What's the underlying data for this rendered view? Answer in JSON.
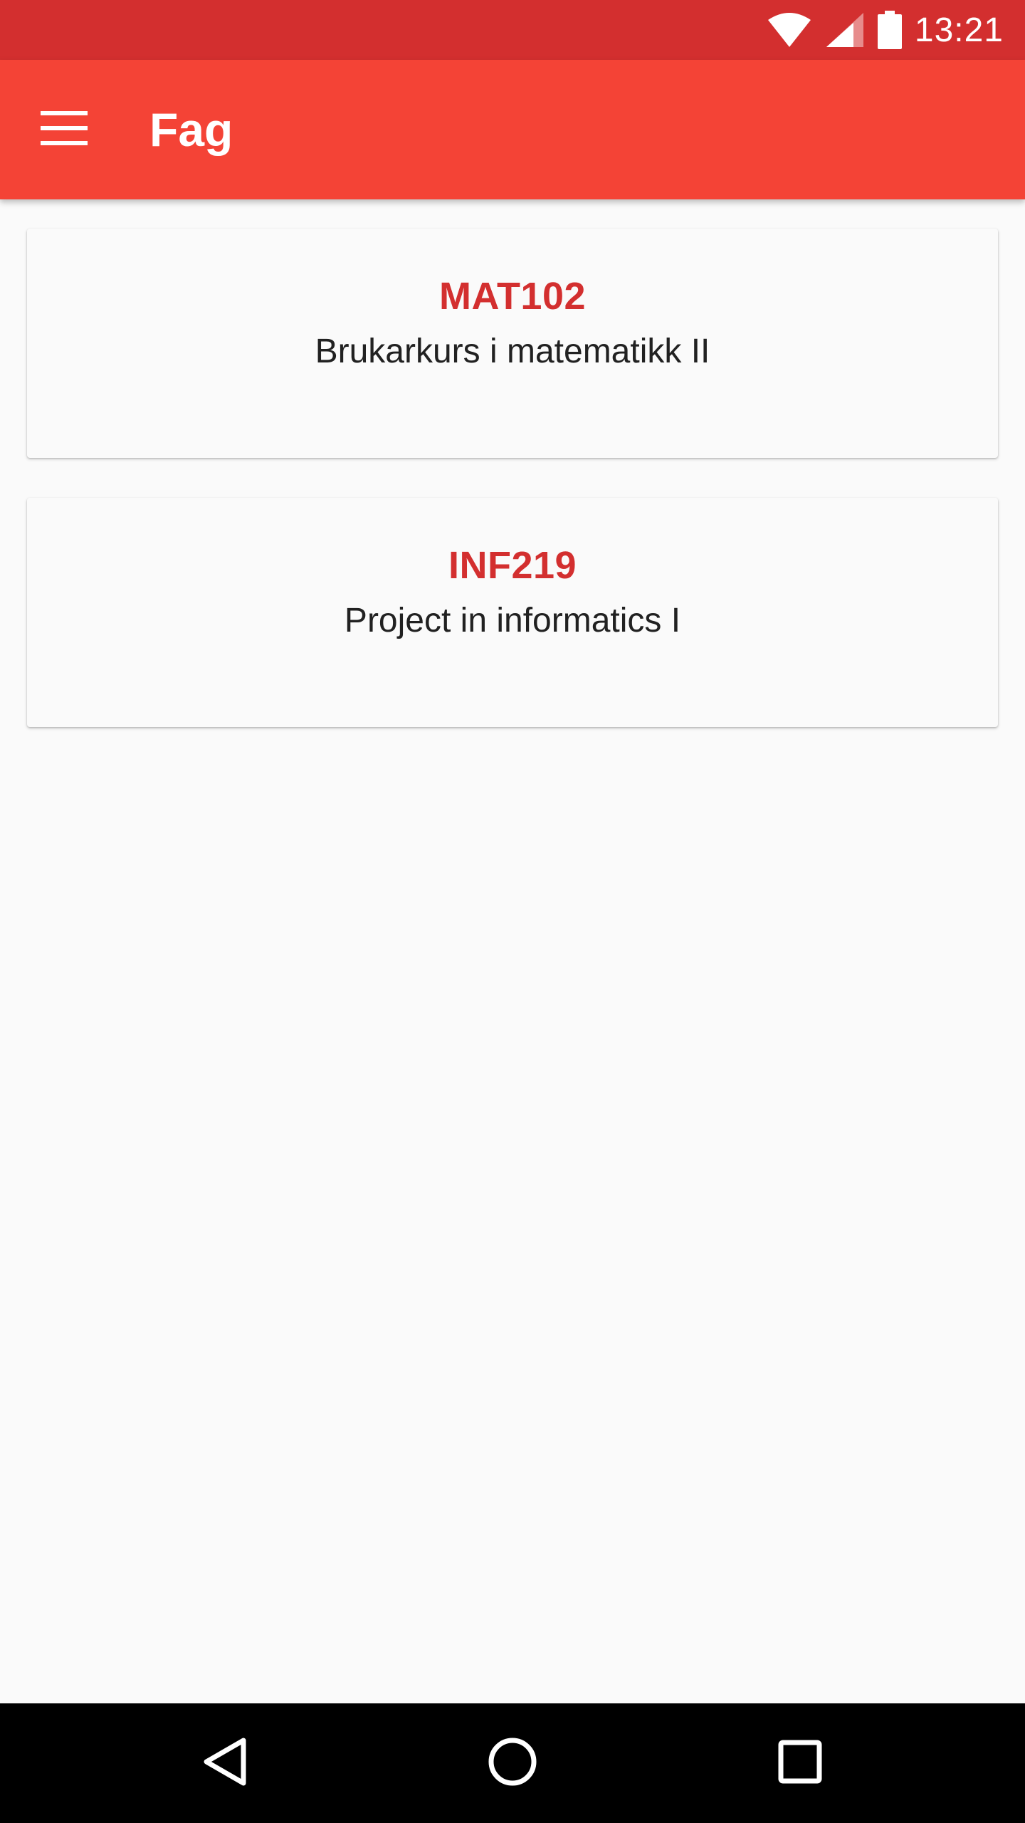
{
  "status_bar": {
    "time": "13:21",
    "icons": [
      "wifi-icon",
      "cell-signal-icon",
      "battery-icon"
    ]
  },
  "app_bar": {
    "menu_icon": "hamburger-menu-icon",
    "title": "Fag"
  },
  "courses": [
    {
      "code": "MAT102",
      "name": "Brukarkurs i matematikk II"
    },
    {
      "code": "INF219",
      "name": "Project in informatics I"
    }
  ],
  "nav_bar": {
    "icons": [
      "back-icon",
      "home-icon",
      "recents-icon"
    ]
  },
  "colors": {
    "primary": "#F44336",
    "primary_dark": "#D32F2F",
    "accent_text": "#D32F2F",
    "background": "#FAFAFA",
    "body_text": "#212121"
  }
}
